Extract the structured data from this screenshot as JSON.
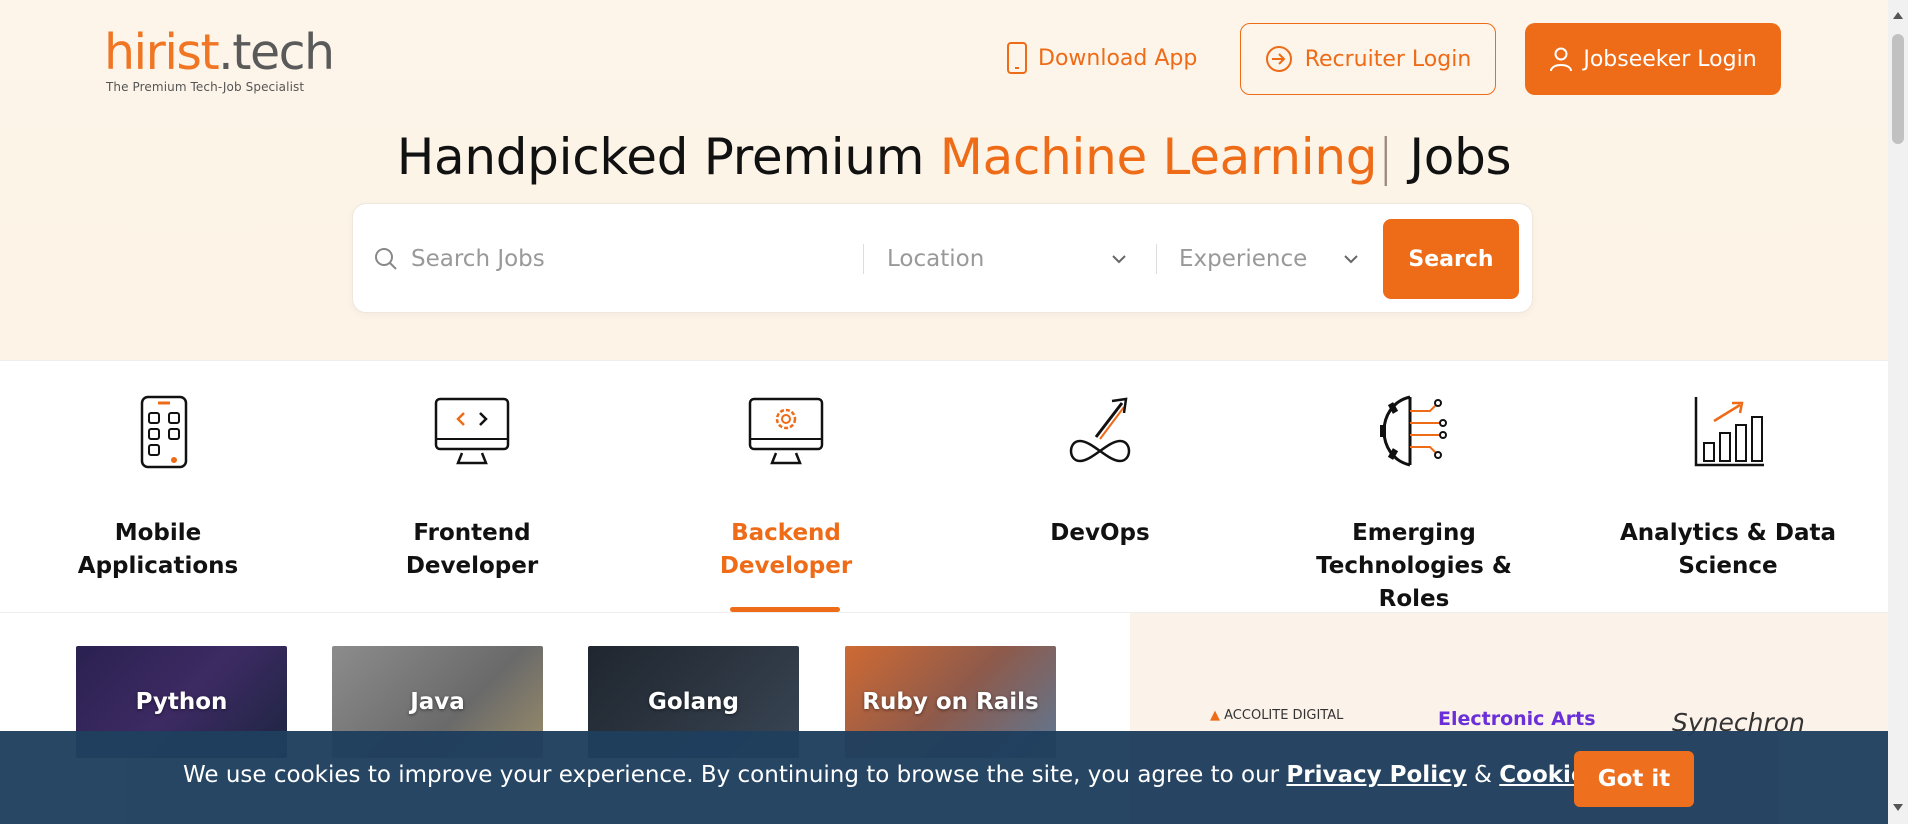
{
  "header": {
    "logo_main": "hirist",
    "logo_dot_tech": ".tech",
    "logo_tagline": "The Premium Tech-Job Specialist",
    "download_app": "Download App",
    "recruiter_login": "Recruiter Login",
    "jobseeker_login": "Jobseeker Login"
  },
  "hero": {
    "headline_prefix": "Handpicked Premium",
    "headline_highlight": "Machine Learning",
    "headline_cursor": "|",
    "headline_suffix": "Jobs"
  },
  "search": {
    "placeholder": "Search Jobs",
    "location_label": "Location",
    "experience_label": "Experience",
    "button_label": "Search"
  },
  "categories": [
    {
      "label_line1": "Mobile",
      "label_line2": "Applications",
      "label_line3": "",
      "icon": "mobile-app-icon"
    },
    {
      "label_line1": "Frontend",
      "label_line2": "Developer",
      "label_line3": "",
      "icon": "frontend-monitor-icon"
    },
    {
      "label_line1": "Backend",
      "label_line2": "Developer",
      "label_line3": "",
      "icon": "backend-monitor-gear-icon",
      "active": true
    },
    {
      "label_line1": "DevOps",
      "label_line2": "",
      "label_line3": "",
      "icon": "devops-infinity-icon"
    },
    {
      "label_line1": "Emerging",
      "label_line2": "Technologies &",
      "label_line3": "Roles",
      "icon": "emerging-tech-gear-icon"
    },
    {
      "label_line1": "Analytics & Data",
      "label_line2": "Science",
      "label_line3": "",
      "icon": "analytics-chart-icon"
    }
  ],
  "skill_tiles": [
    "Python",
    "Java",
    "Golang",
    "Ruby on Rails"
  ],
  "companies": [
    "ACCOLITE DIGITAL",
    "Electronic Arts",
    "Synechron"
  ],
  "cookie": {
    "text": "We use cookies to improve your experience. By continuing to browse the site, you agree to our",
    "privacy_link": "Privacy Policy",
    "amp": "&",
    "cookie_link": "Cookie Policy.",
    "button": "Got it"
  },
  "colors": {
    "accent": "#ee6b17",
    "hero_bg": "#fdf5ea",
    "cookie_bg": "#1f3f5e"
  }
}
